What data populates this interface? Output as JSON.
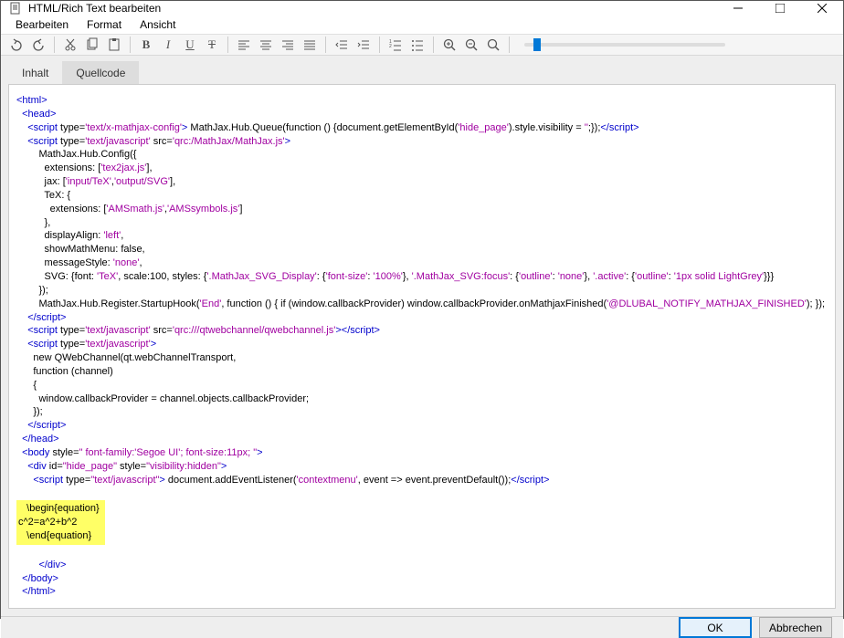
{
  "window": {
    "title": "HTML/Rich Text bearbeiten"
  },
  "menu": {
    "edit": "Bearbeiten",
    "format": "Format",
    "view": "Ansicht"
  },
  "tabs": {
    "content": "Inhalt",
    "source": "Quellcode"
  },
  "footer": {
    "ok": "OK",
    "cancel": "Abbrechen"
  },
  "code": {
    "l01a": "<html>",
    "l02a": "<head>",
    "l03a": "<script",
    "l03b": " type=",
    "l03c": "'text/x-mathjax-config'",
    "l03d": ">",
    "l03e": " MathJax.Hub.Queue(function () {document.getElementById(",
    "l03f": "'hide_page'",
    "l03g": ").style.visibility = ",
    "l03h": "''",
    "l03i": ";});",
    "l03j": "</script>",
    "l04a": "<script",
    "l04b": " type=",
    "l04c": "'text/javascript'",
    "l04d": " src=",
    "l04e": "'qrc:/MathJax/MathJax.js'",
    "l04f": ">",
    "l05": "        MathJax.Hub.Config({",
    "l06a": "          extensions: [",
    "l06b": "'tex2jax.js'",
    "l06c": "],",
    "l07a": "          jax: [",
    "l07b": "'input/TeX'",
    "l07c": ",",
    "l07d": "'output/SVG'",
    "l07e": "],",
    "l08": "          TeX: {",
    "l09a": "            extensions: [",
    "l09b": "'AMSmath.js'",
    "l09c": ",",
    "l09d": "'AMSsymbols.js'",
    "l09e": "]",
    "l10": "          },",
    "l11a": "          displayAlign: ",
    "l11b": "'left'",
    "l11c": ",",
    "l12": "          showMathMenu: false,",
    "l13a": "          messageStyle: ",
    "l13b": "'none'",
    "l13c": ",",
    "l14a": "          SVG: {font: ",
    "l14b": "'TeX'",
    "l14c": ", scale:100, styles: {",
    "l14d": "'.MathJax_SVG_Display'",
    "l14e": ": {",
    "l14f": "'font-size'",
    "l14g": ": ",
    "l14h": "'100%'",
    "l14i": "}, ",
    "l14j": "'.MathJax_SVG:focus'",
    "l14k": ": {",
    "l14l": "'outline'",
    "l14m": ": ",
    "l14n": "'none'",
    "l14o": "}, ",
    "l14p": "'.active'",
    "l14q": ": {",
    "l14r": "'outline'",
    "l14s": ": ",
    "l14t": "'1px solid LightGrey'",
    "l14u": "}}}",
    "l15": "        });",
    "l16a": "        MathJax.Hub.Register.StartupHook(",
    "l16b": "'End'",
    "l16c": ", function () { if (window.callbackProvider) window.callbackProvider.onMathjaxFinished(",
    "l16d": "'@DLUBAL_NOTIFY_MATHJAX_FINISHED'",
    "l16e": "); });",
    "l17": "</script>",
    "l18a": "<script",
    "l18b": " type=",
    "l18c": "'text/javascript'",
    "l18d": " src=",
    "l18e": "'qrc:///qtwebchannel/qwebchannel.js'",
    "l18f": ">",
    "l18g": "</script>",
    "l19a": "<script",
    "l19b": " type=",
    "l19c": "'text/javascript'",
    "l19d": ">",
    "l20": "      new QWebChannel(qt.webChannelTransport,",
    "l21": "      function (channel)",
    "l22": "      {",
    "l23": "        window.callbackProvider = channel.objects.callbackProvider;",
    "l24": "      });",
    "l25": "</script>",
    "l26": "</head>",
    "l27a": "<body",
    "l27b": " style=",
    "l27c": "\" font-family:'Segoe UI'; font-size:11px; \"",
    "l27d": ">",
    "l28a": "<div",
    "l28b": " id=",
    "l28c": "\"hide_page\"",
    "l28d": " style=",
    "l28e": "\"visibility:hidden\"",
    "l28f": ">",
    "l29a": "<script",
    "l29b": " type=",
    "l29c": "\"text/javascript\"",
    "l29d": ">",
    "l29e": " document.addEventListener(",
    "l29f": "'contextmenu'",
    "l29g": ", event => event.preventDefault());",
    "l29h": "</script>",
    "eq1": "   \\begin{equation}",
    "eq2": "c^2=a^2+b^2",
    "eq3": "   \\end{equation}",
    "l33": "</div>",
    "l34": "</body>",
    "l35": "</html>"
  }
}
